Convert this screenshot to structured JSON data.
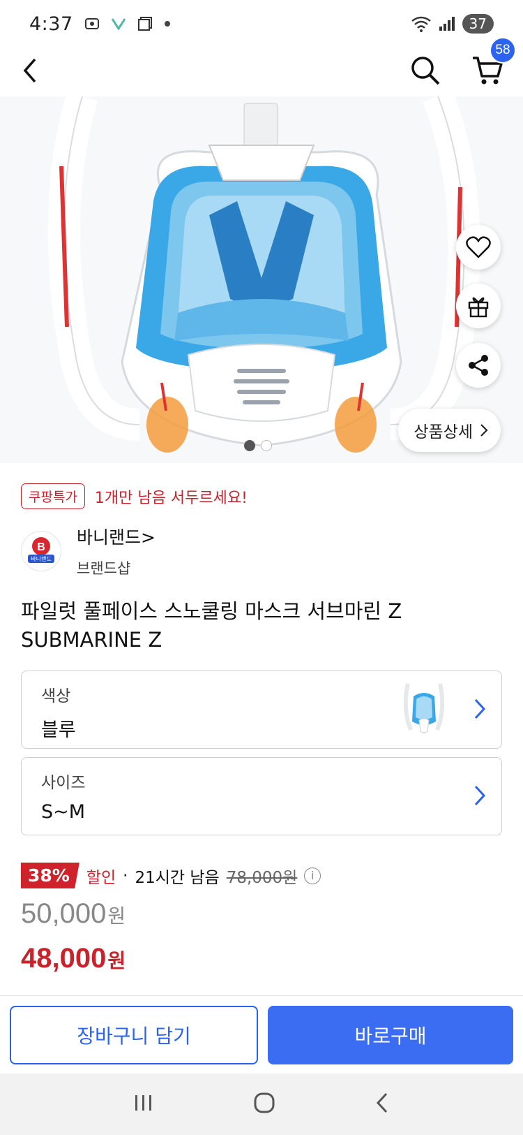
{
  "status_bar": {
    "time": "4:37",
    "battery": "37"
  },
  "header": {
    "cart_count": "58"
  },
  "hero": {
    "detail_label": "상품상세",
    "page_count": 2,
    "active_page": 1
  },
  "promo": {
    "tag": "쿠팡특가",
    "text": "1개만 남음 서두르세요!"
  },
  "seller": {
    "name": "바니랜드>",
    "sub": "브랜드샵",
    "logo_text": "B 바니랜드"
  },
  "product": {
    "title": "파일럿 풀페이스 스노쿨링 마스크 서브마린 Z SUBMARINE Z"
  },
  "options": [
    {
      "label": "색상",
      "value": "블루"
    },
    {
      "label": "사이즈",
      "value": "S~M"
    }
  ],
  "price": {
    "discount_pct": "38%",
    "discount_label": "할인",
    "separator": "·",
    "time_left": "21시간 남음",
    "original": "78,000원",
    "base_price": "50,000",
    "sale_price": "48,000",
    "currency": "원"
  },
  "actions": {
    "cart": "장바구니 담기",
    "buy": "바로구매"
  },
  "colors": {
    "accent_blue": "#2b63f0",
    "sale_red": "#c8222b"
  }
}
